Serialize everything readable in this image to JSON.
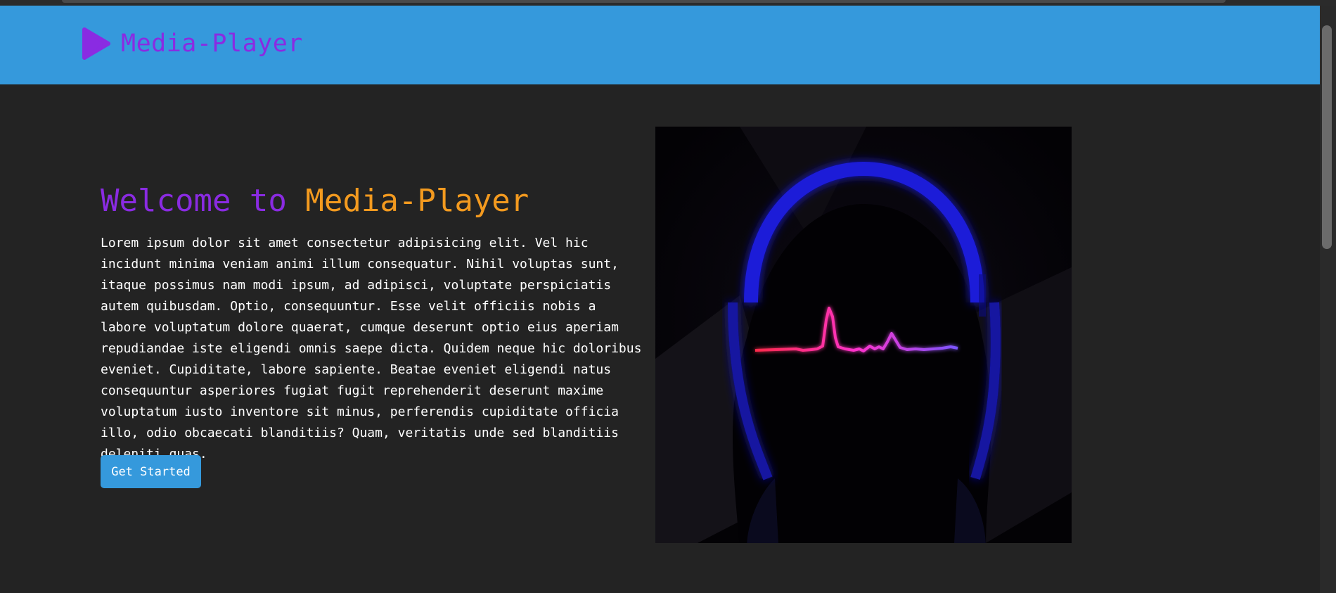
{
  "header": {
    "brand": "Media-Player",
    "brand_color": "#8a2be2",
    "background_color": "#3599dc",
    "logo_icon": "play-icon"
  },
  "hero": {
    "title_part1": "Welcome to ",
    "title_part2": "Media-Player",
    "title_color_1": "#8a2be2",
    "title_color_2": "#f39a1f",
    "body": "Lorem ipsum dolor sit amet consectetur adipisicing elit. Vel hic incidunt minima veniam animi illum consequatur. Nihil voluptas sunt, itaque possimus nam modi ipsum, ad adipisci, voluptate perspiciatis autem quibusdam. Optio, consequuntur. Esse velit officiis nobis a labore voluptatum dolore quaerat, cumque deserunt optio eius aperiam repudiandae iste eligendi omnis saepe dicta. Quidem neque hic doloribus eveniet. Cupiditate, labore sapiente. Beatae eveniet eligendi natus consequuntur asperiores fugiat fugit reprehenderit deserunt maxime voluptatum iusto inventore sit minus, perferendis cupiditate officia illo, odio obcaecati blanditiis? Quam, veritatis unde sed blanditiis deleniti quas.",
    "cta_label": "Get Started",
    "image_icon": "headphones-heartbeat-illustration"
  }
}
